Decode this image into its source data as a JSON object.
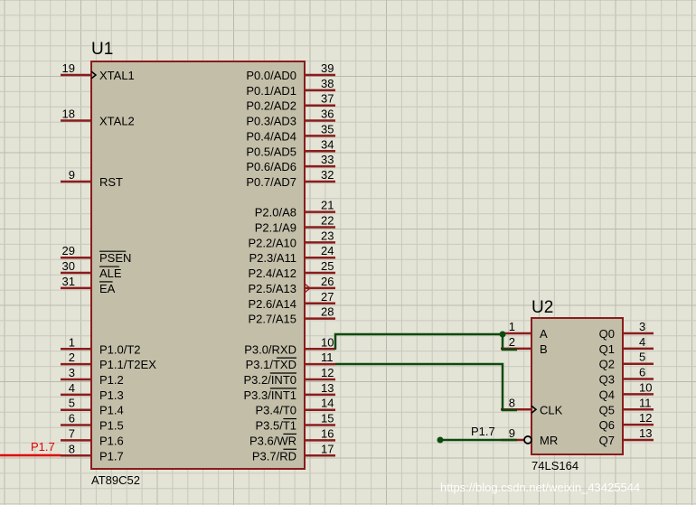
{
  "u1": {
    "ref": "U1",
    "part": "AT89C52",
    "left_pins": [
      {
        "num": "19",
        "name": "XTAL1",
        "row": 0,
        "clock": true
      },
      {
        "num": "18",
        "name": "XTAL2",
        "row": 3
      },
      {
        "num": "9",
        "name": "RST",
        "row": 7
      },
      {
        "num": "29",
        "name": "PSEN",
        "row": 12,
        "bar": true
      },
      {
        "num": "30",
        "name": "ALE",
        "row": 13,
        "bar": true
      },
      {
        "num": "31",
        "name": "EA",
        "row": 14,
        "bar": true
      },
      {
        "num": "1",
        "name": "P1.0/T2",
        "row": 18
      },
      {
        "num": "2",
        "name": "P1.1/T2EX",
        "row": 19
      },
      {
        "num": "3",
        "name": "P1.2",
        "row": 20
      },
      {
        "num": "4",
        "name": "P1.3",
        "row": 21
      },
      {
        "num": "5",
        "name": "P1.4",
        "row": 22
      },
      {
        "num": "6",
        "name": "P1.5",
        "row": 23
      },
      {
        "num": "7",
        "name": "P1.6",
        "row": 24
      },
      {
        "num": "8",
        "name": "P1.7",
        "row": 25
      }
    ],
    "right_pins": [
      {
        "num": "39",
        "name": "P0.0/AD0",
        "row": 0
      },
      {
        "num": "38",
        "name": "P0.1/AD1",
        "row": 1
      },
      {
        "num": "37",
        "name": "P0.2/AD2",
        "row": 2
      },
      {
        "num": "36",
        "name": "P0.3/AD3",
        "row": 3
      },
      {
        "num": "35",
        "name": "P0.4/AD4",
        "row": 4
      },
      {
        "num": "34",
        "name": "P0.5/AD5",
        "row": 5
      },
      {
        "num": "33",
        "name": "P0.6/AD6",
        "row": 6
      },
      {
        "num": "32",
        "name": "P0.7/AD7",
        "row": 7
      },
      {
        "num": "21",
        "name": "P2.0/A8",
        "row": 9
      },
      {
        "num": "22",
        "name": "P2.1/A9",
        "row": 10
      },
      {
        "num": "23",
        "name": "P2.2/A10",
        "row": 11
      },
      {
        "num": "24",
        "name": "P2.3/A11",
        "row": 12
      },
      {
        "num": "25",
        "name": "P2.4/A12",
        "row": 13
      },
      {
        "num": "26",
        "name": "P2.5/A13",
        "row": 14
      },
      {
        "num": "27",
        "name": "P2.6/A14",
        "row": 15
      },
      {
        "num": "28",
        "name": "P2.7/A15",
        "row": 16
      },
      {
        "num": "10",
        "name": "P3.0/RXD",
        "row": 18
      },
      {
        "num": "11",
        "name": "P3.1/TXD",
        "row": 19,
        "barPart": "TXD"
      },
      {
        "num": "12",
        "name": "P3.2/INT0",
        "row": 20,
        "barPart": "INT0"
      },
      {
        "num": "13",
        "name": "P3.3/INT1",
        "row": 21,
        "barPart": "INT1"
      },
      {
        "num": "14",
        "name": "P3.4/T0",
        "row": 22
      },
      {
        "num": "15",
        "name": "P3.5/T1",
        "row": 23,
        "barPart": "T1"
      },
      {
        "num": "16",
        "name": "P3.6/WR",
        "row": 24,
        "barPart": "WR"
      },
      {
        "num": "17",
        "name": "P3.7/RD",
        "row": 25,
        "barPart": "RD"
      }
    ]
  },
  "u2": {
    "ref": "U2",
    "part": "74LS164",
    "left_pins": [
      {
        "num": "1",
        "name": "A",
        "row": 0
      },
      {
        "num": "2",
        "name": "B",
        "row": 1
      },
      {
        "num": "8",
        "name": "CLK",
        "row": 5,
        "clock": true
      },
      {
        "num": "9",
        "name": "MR",
        "row": 7,
        "inverted": true
      }
    ],
    "right_pins": [
      {
        "num": "3",
        "name": "Q0",
        "row": 0
      },
      {
        "num": "4",
        "name": "Q1",
        "row": 1
      },
      {
        "num": "5",
        "name": "Q2",
        "row": 2
      },
      {
        "num": "6",
        "name": "Q3",
        "row": 3
      },
      {
        "num": "10",
        "name": "Q4",
        "row": 4
      },
      {
        "num": "11",
        "name": "Q5",
        "row": 5
      },
      {
        "num": "12",
        "name": "Q6",
        "row": 6
      },
      {
        "num": "13",
        "name": "Q7",
        "row": 7
      }
    ]
  },
  "nets": {
    "p17_left": "P1.7",
    "p17_mr": "P1.7"
  },
  "colors": {
    "background": "#e3e3d6",
    "component_outline": "#8a1c1c",
    "component_fill": "#c2bea8",
    "wire": "#0d4a0d",
    "net_red": "#e00000"
  },
  "watermark": "https://blog.csdn.net/weixin_43425544"
}
